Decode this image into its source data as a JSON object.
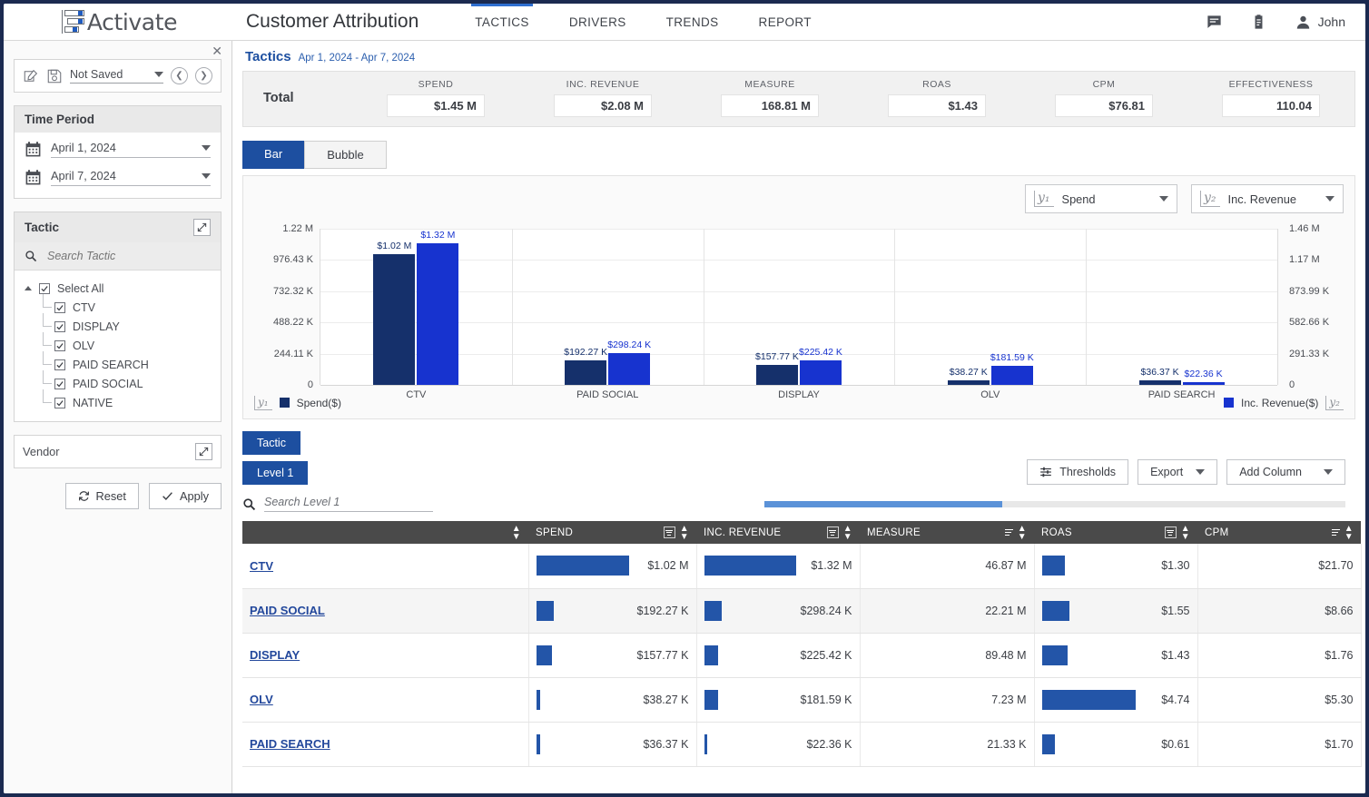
{
  "header": {
    "logo_text": "Activate",
    "app_title": "Customer Attribution",
    "nav": [
      {
        "label": "TACTICS",
        "active": true
      },
      {
        "label": "DRIVERS",
        "active": false
      },
      {
        "label": "TRENDS",
        "active": false
      },
      {
        "label": "REPORT",
        "active": false
      }
    ],
    "user_name": "John"
  },
  "sidebar": {
    "saved_value": "Not Saved",
    "time_period": {
      "title": "Time Period",
      "start_date": "April 1, 2024",
      "end_date": "April 7, 2024"
    },
    "tactic": {
      "title": "Tactic",
      "search_placeholder": "Search Tactic",
      "select_all_label": "Select All",
      "items": [
        {
          "label": "CTV",
          "checked": true
        },
        {
          "label": "DISPLAY",
          "checked": true
        },
        {
          "label": "OLV",
          "checked": true
        },
        {
          "label": "PAID SEARCH",
          "checked": true
        },
        {
          "label": "PAID SOCIAL",
          "checked": true
        },
        {
          "label": "NATIVE",
          "checked": true
        }
      ]
    },
    "vendor_label": "Vendor",
    "reset_label": "Reset",
    "apply_label": "Apply"
  },
  "main": {
    "page_title": "Tactics",
    "date_range": "Apr 1, 2024 - Apr 7, 2024",
    "totals": {
      "label": "Total",
      "cells": [
        {
          "key": "SPEND",
          "value": "$1.45 M"
        },
        {
          "key": "INC. REVENUE",
          "value": "$2.08 M"
        },
        {
          "key": "MEASURE",
          "value": "168.81 M"
        },
        {
          "key": "ROAS",
          "value": "$1.43"
        },
        {
          "key": "CPM",
          "value": "$76.81"
        },
        {
          "key": "EFFECTIVENESS",
          "value": "110.04"
        }
      ]
    },
    "chart_tabs": [
      {
        "label": "Bar",
        "active": true
      },
      {
        "label": "Bubble",
        "active": false
      }
    ],
    "y1_selector": {
      "badge": "y₁",
      "value": "Spend"
    },
    "y2_selector": {
      "badge": "y₂",
      "value": "Inc. Revenue"
    },
    "legend_left": {
      "badge": "y₁",
      "label": "Spend($)"
    },
    "legend_right": {
      "badge": "y₂",
      "label": "Inc. Revenue($)"
    },
    "level_tabs": [
      {
        "label": "Tactic"
      },
      {
        "label": "Level 1"
      }
    ],
    "table_search_placeholder": "Search Level 1",
    "toolbar": [
      {
        "label": "Thresholds",
        "icon": "sliders-icon"
      },
      {
        "label": "Export",
        "icon": "chevron-down-icon"
      },
      {
        "label": "Add Column",
        "icon": "chevron-down-icon"
      }
    ]
  },
  "chart_data": {
    "type": "bar",
    "title": "",
    "categories": [
      "CTV",
      "PAID SOCIAL",
      "DISPLAY",
      "OLV",
      "PAID SEARCH"
    ],
    "series": [
      {
        "name": "Spend($)",
        "axis": "y1",
        "color": "#15306b",
        "values": [
          1020000,
          192270,
          157770,
          38270,
          36370
        ],
        "labels": [
          "$1.02 M",
          "$192.27 K",
          "$157.77 K",
          "$38.27 K",
          "$36.37 K"
        ]
      },
      {
        "name": "Inc. Revenue($)",
        "axis": "y2",
        "color": "#1733cf",
        "values": [
          1320000,
          298240,
          225420,
          181590,
          22360
        ],
        "labels": [
          "$1.32 M",
          "$298.24 K",
          "$225.42 K",
          "$181.59 K",
          "$22.36 K"
        ]
      }
    ],
    "y1_ticks": [
      "1.22 M",
      "976.43 K",
      "732.32 K",
      "488.22 K",
      "244.11 K",
      "0"
    ],
    "y1_lim": [
      0,
      1220000
    ],
    "y2_ticks": [
      "1.46 M",
      "1.17 M",
      "873.99 K",
      "582.66 K",
      "291.33 K",
      "0"
    ],
    "y2_lim": [
      0,
      1456650
    ],
    "xlabel": "",
    "ylabel": "Spend($)",
    "y2label": "Inc. Revenue($)",
    "grid": true,
    "legend_position": "bottom"
  },
  "table": {
    "columns": [
      "",
      "SPEND",
      "INC. REVENUE",
      "MEASURE",
      "ROAS",
      "CPM"
    ],
    "rows": [
      {
        "name": "CTV",
        "spend": "$1.02 M",
        "spend_pct": 100,
        "revenue": "$1.32 M",
        "revenue_pct": 100,
        "measure": "46.87 M",
        "roas": "$1.30",
        "roas_pct": 27,
        "cpm": "$21.70"
      },
      {
        "name": "PAID SOCIAL",
        "spend": "$192.27 K",
        "spend_pct": 19,
        "revenue": "$298.24 K",
        "revenue_pct": 19,
        "measure": "22.21 M",
        "roas": "$1.55",
        "roas_pct": 33,
        "cpm": "$8.66"
      },
      {
        "name": "DISPLAY",
        "spend": "$157.77 K",
        "spend_pct": 16,
        "revenue": "$225.42 K",
        "revenue_pct": 16,
        "measure": "89.48 M",
        "roas": "$1.43",
        "roas_pct": 30,
        "cpm": "$1.76"
      },
      {
        "name": "OLV",
        "spend": "$38.27 K",
        "spend_pct": 4,
        "revenue": "$181.59 K",
        "revenue_pct": 13,
        "measure": "7.23 M",
        "roas": "$4.74",
        "roas_pct": 100,
        "cpm": "$5.30"
      },
      {
        "name": "PAID SEARCH",
        "spend": "$36.37 K",
        "spend_pct": 4,
        "revenue": "$22.36 K",
        "revenue_pct": 3,
        "measure": "21.33 K",
        "roas": "$0.61",
        "roas_pct": 13,
        "cpm": "$1.70"
      }
    ]
  },
  "colors": {
    "brand_blue": "#1d4fa0",
    "spend": "#15306b",
    "revenue": "#1733cf",
    "header_dark": "#4a4a4a"
  }
}
